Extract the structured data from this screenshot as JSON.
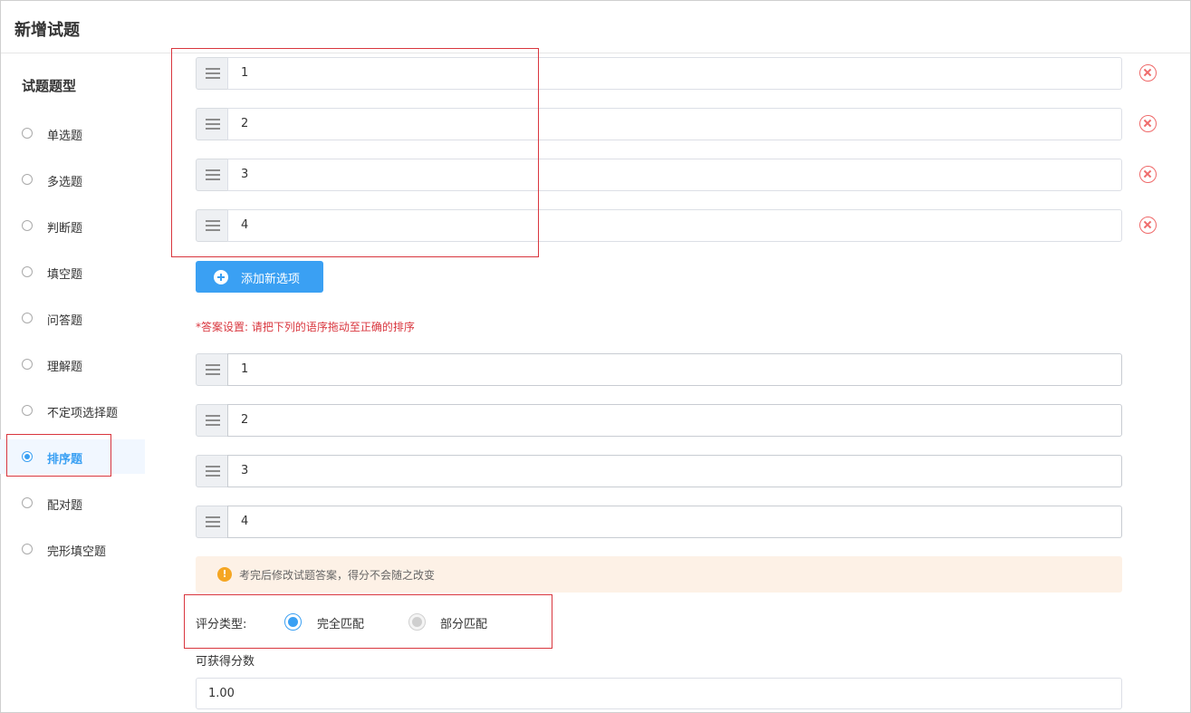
{
  "header": {
    "title": "新增试题"
  },
  "sidebar": {
    "title": "试题题型",
    "items": [
      {
        "label": "单选题",
        "selected": false
      },
      {
        "label": "多选题",
        "selected": false
      },
      {
        "label": "判断题",
        "selected": false
      },
      {
        "label": "填空题",
        "selected": false
      },
      {
        "label": "问答题",
        "selected": false
      },
      {
        "label": "理解题",
        "selected": false
      },
      {
        "label": "不定项选择题",
        "selected": false
      },
      {
        "label": "排序题",
        "selected": true
      },
      {
        "label": "配对题",
        "selected": false
      },
      {
        "label": "完形填空题",
        "selected": false
      }
    ]
  },
  "options": {
    "items": [
      "1",
      "2",
      "3",
      "4"
    ],
    "add_button_label": "添加新选项",
    "drag_icon": "drag-handle-icon",
    "delete_icon": "delete-circle-icon"
  },
  "answer": {
    "hint": "*答案设置: 请把下列的语序拖动至正确的排序",
    "items": [
      "1",
      "2",
      "3",
      "4"
    ]
  },
  "notice": {
    "icon": "warning-icon",
    "text": "考完后修改试题答案，得分不会随之改变"
  },
  "scoring": {
    "label": "评分类型:",
    "options": [
      {
        "label": "完全匹配",
        "selected": true
      },
      {
        "label": "部分匹配",
        "selected": false
      }
    ]
  },
  "points": {
    "label": "可获得分数",
    "value": "1.00"
  },
  "colors": {
    "accent": "#3aa0f3",
    "danger": "#d9363e",
    "notice_bg": "#fdf1e6"
  }
}
